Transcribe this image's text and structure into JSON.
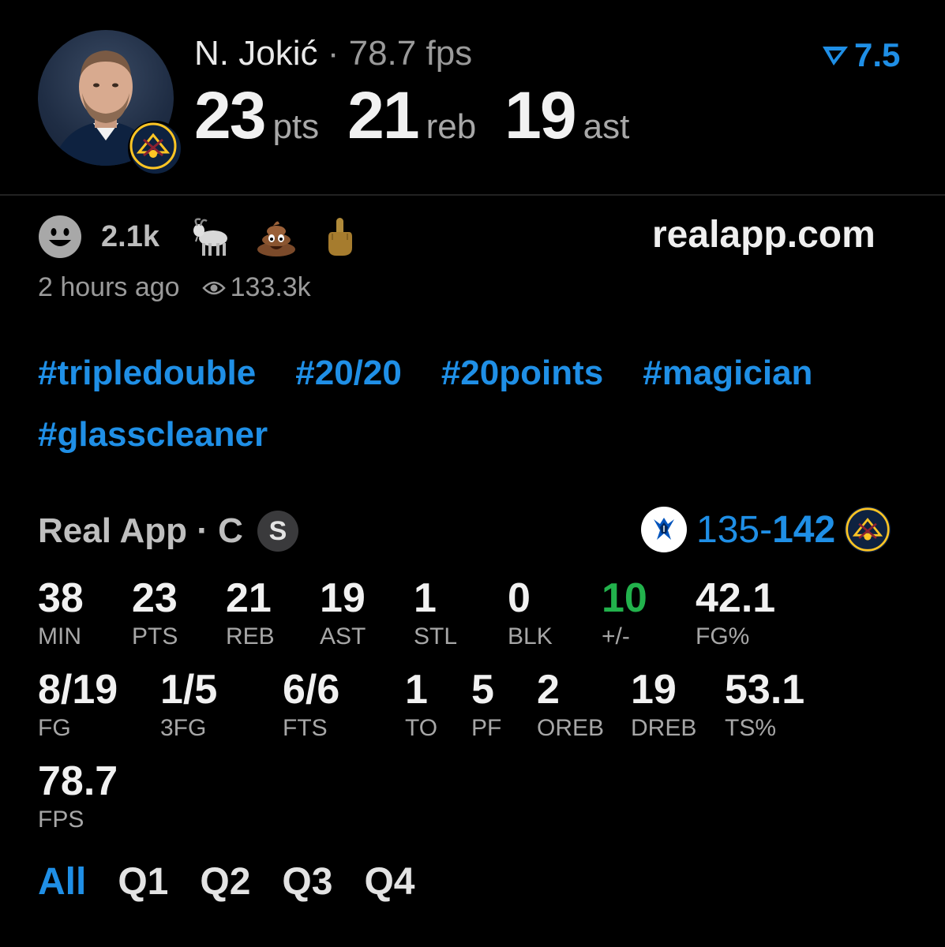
{
  "player": {
    "name": "N. Jokić",
    "separator": "·",
    "fps_text": "78.7 fps",
    "headline": [
      {
        "value": "23",
        "unit": "pts"
      },
      {
        "value": "21",
        "unit": "reb"
      },
      {
        "value": "19",
        "unit": "ast"
      }
    ],
    "rating": "7.5",
    "rating_icon": "real-app-rating-icon",
    "team_logo": "denver-nuggets-logo"
  },
  "reactions": {
    "count": "2.1k",
    "items": [
      "smiley-face-icon",
      "goat-emoji",
      "poop-emoji",
      "middle-finger-emoji"
    ]
  },
  "site": "realapp.com",
  "meta": {
    "time": "2 hours ago",
    "views": "133.3k"
  },
  "hashtags": [
    "#tripledouble",
    "#20/20",
    "#20points",
    "#magician",
    "#glasscleaner"
  ],
  "game": {
    "source": "Real App · C",
    "badge": "S",
    "away_logo": "dallas-mavericks-logo",
    "away_score": "135",
    "dash": "-",
    "home_score": "142",
    "home_logo": "denver-nuggets-logo",
    "stats": [
      {
        "value": "38",
        "label": "MIN"
      },
      {
        "value": "23",
        "label": "PTS"
      },
      {
        "value": "21",
        "label": "REB"
      },
      {
        "value": "19",
        "label": "AST"
      },
      {
        "value": "1",
        "label": "STL"
      },
      {
        "value": "0",
        "label": "BLK"
      },
      {
        "value": "10",
        "label": "+/-"
      },
      {
        "value": "42.1",
        "label": "FG%"
      },
      {
        "value": "8/19",
        "label": "FG"
      },
      {
        "value": "1/5",
        "label": "3FG"
      },
      {
        "value": "6/6",
        "label": "FTS"
      },
      {
        "value": "1",
        "label": "TO"
      },
      {
        "value": "5",
        "label": "PF"
      },
      {
        "value": "2",
        "label": "OREB"
      },
      {
        "value": "19",
        "label": "DREB"
      },
      {
        "value": "53.1",
        "label": "TS%"
      },
      {
        "value": "78.7",
        "label": "FPS"
      }
    ],
    "positive_color": "#22b24c"
  },
  "quarters": {
    "tabs": [
      "All",
      "Q1",
      "Q2",
      "Q3",
      "Q4"
    ],
    "active": "All"
  },
  "colors": {
    "accent": "#1f8fe6",
    "background": "#000000"
  }
}
